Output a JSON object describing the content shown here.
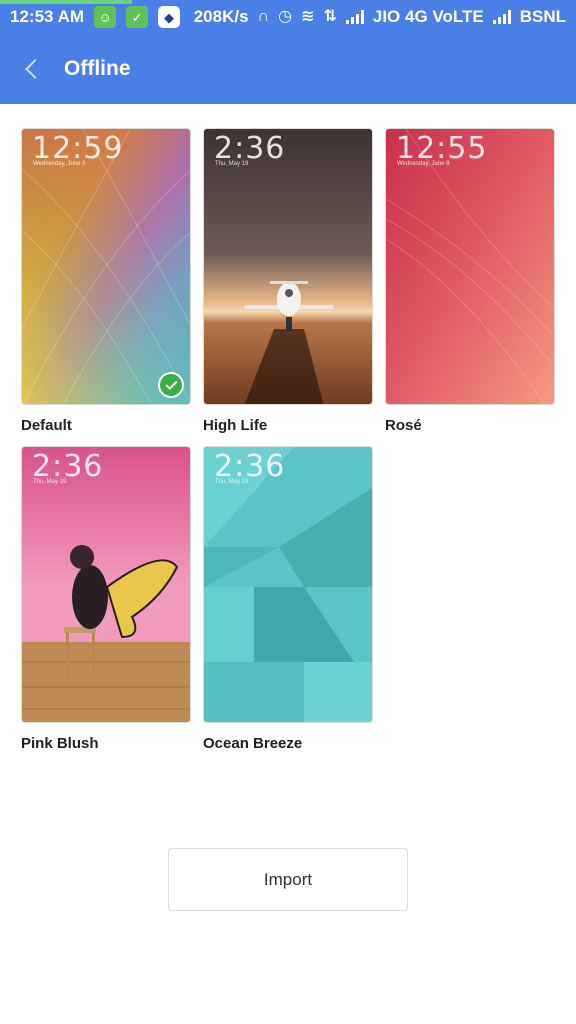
{
  "status_bar": {
    "time": "12:53 AM",
    "speed": "208K/s",
    "carrier1": "JIO 4G VoLTE",
    "carrier2": "BSNL",
    "icons": [
      "notification-app-icon",
      "notification-leaf-icon",
      "shield-icon",
      "headphones-icon",
      "alarm-icon",
      "wifi-icon",
      "data-arrows-icon",
      "signal-icon"
    ]
  },
  "header": {
    "title": "Offline",
    "back_icon": "chevron-left-icon"
  },
  "themes": [
    {
      "name": "Default",
      "clock": "12:59",
      "date": "Wednesday, June 8",
      "selected": true
    },
    {
      "name": "High Life",
      "clock": "2:36",
      "date": "Thu, May 19",
      "selected": false
    },
    {
      "name": "Rosé",
      "clock": "12:55",
      "date": "Wednesday, June 8",
      "selected": false
    },
    {
      "name": "Pink Blush",
      "clock": "2:36",
      "date": "Thu, May 19",
      "selected": false
    },
    {
      "name": "Ocean Breeze",
      "clock": "2:36",
      "date": "Thu, May 19",
      "selected": false
    }
  ],
  "import_label": "Import",
  "colors": {
    "accent": "#4a7fe8",
    "selected_badge": "#3cae44"
  }
}
